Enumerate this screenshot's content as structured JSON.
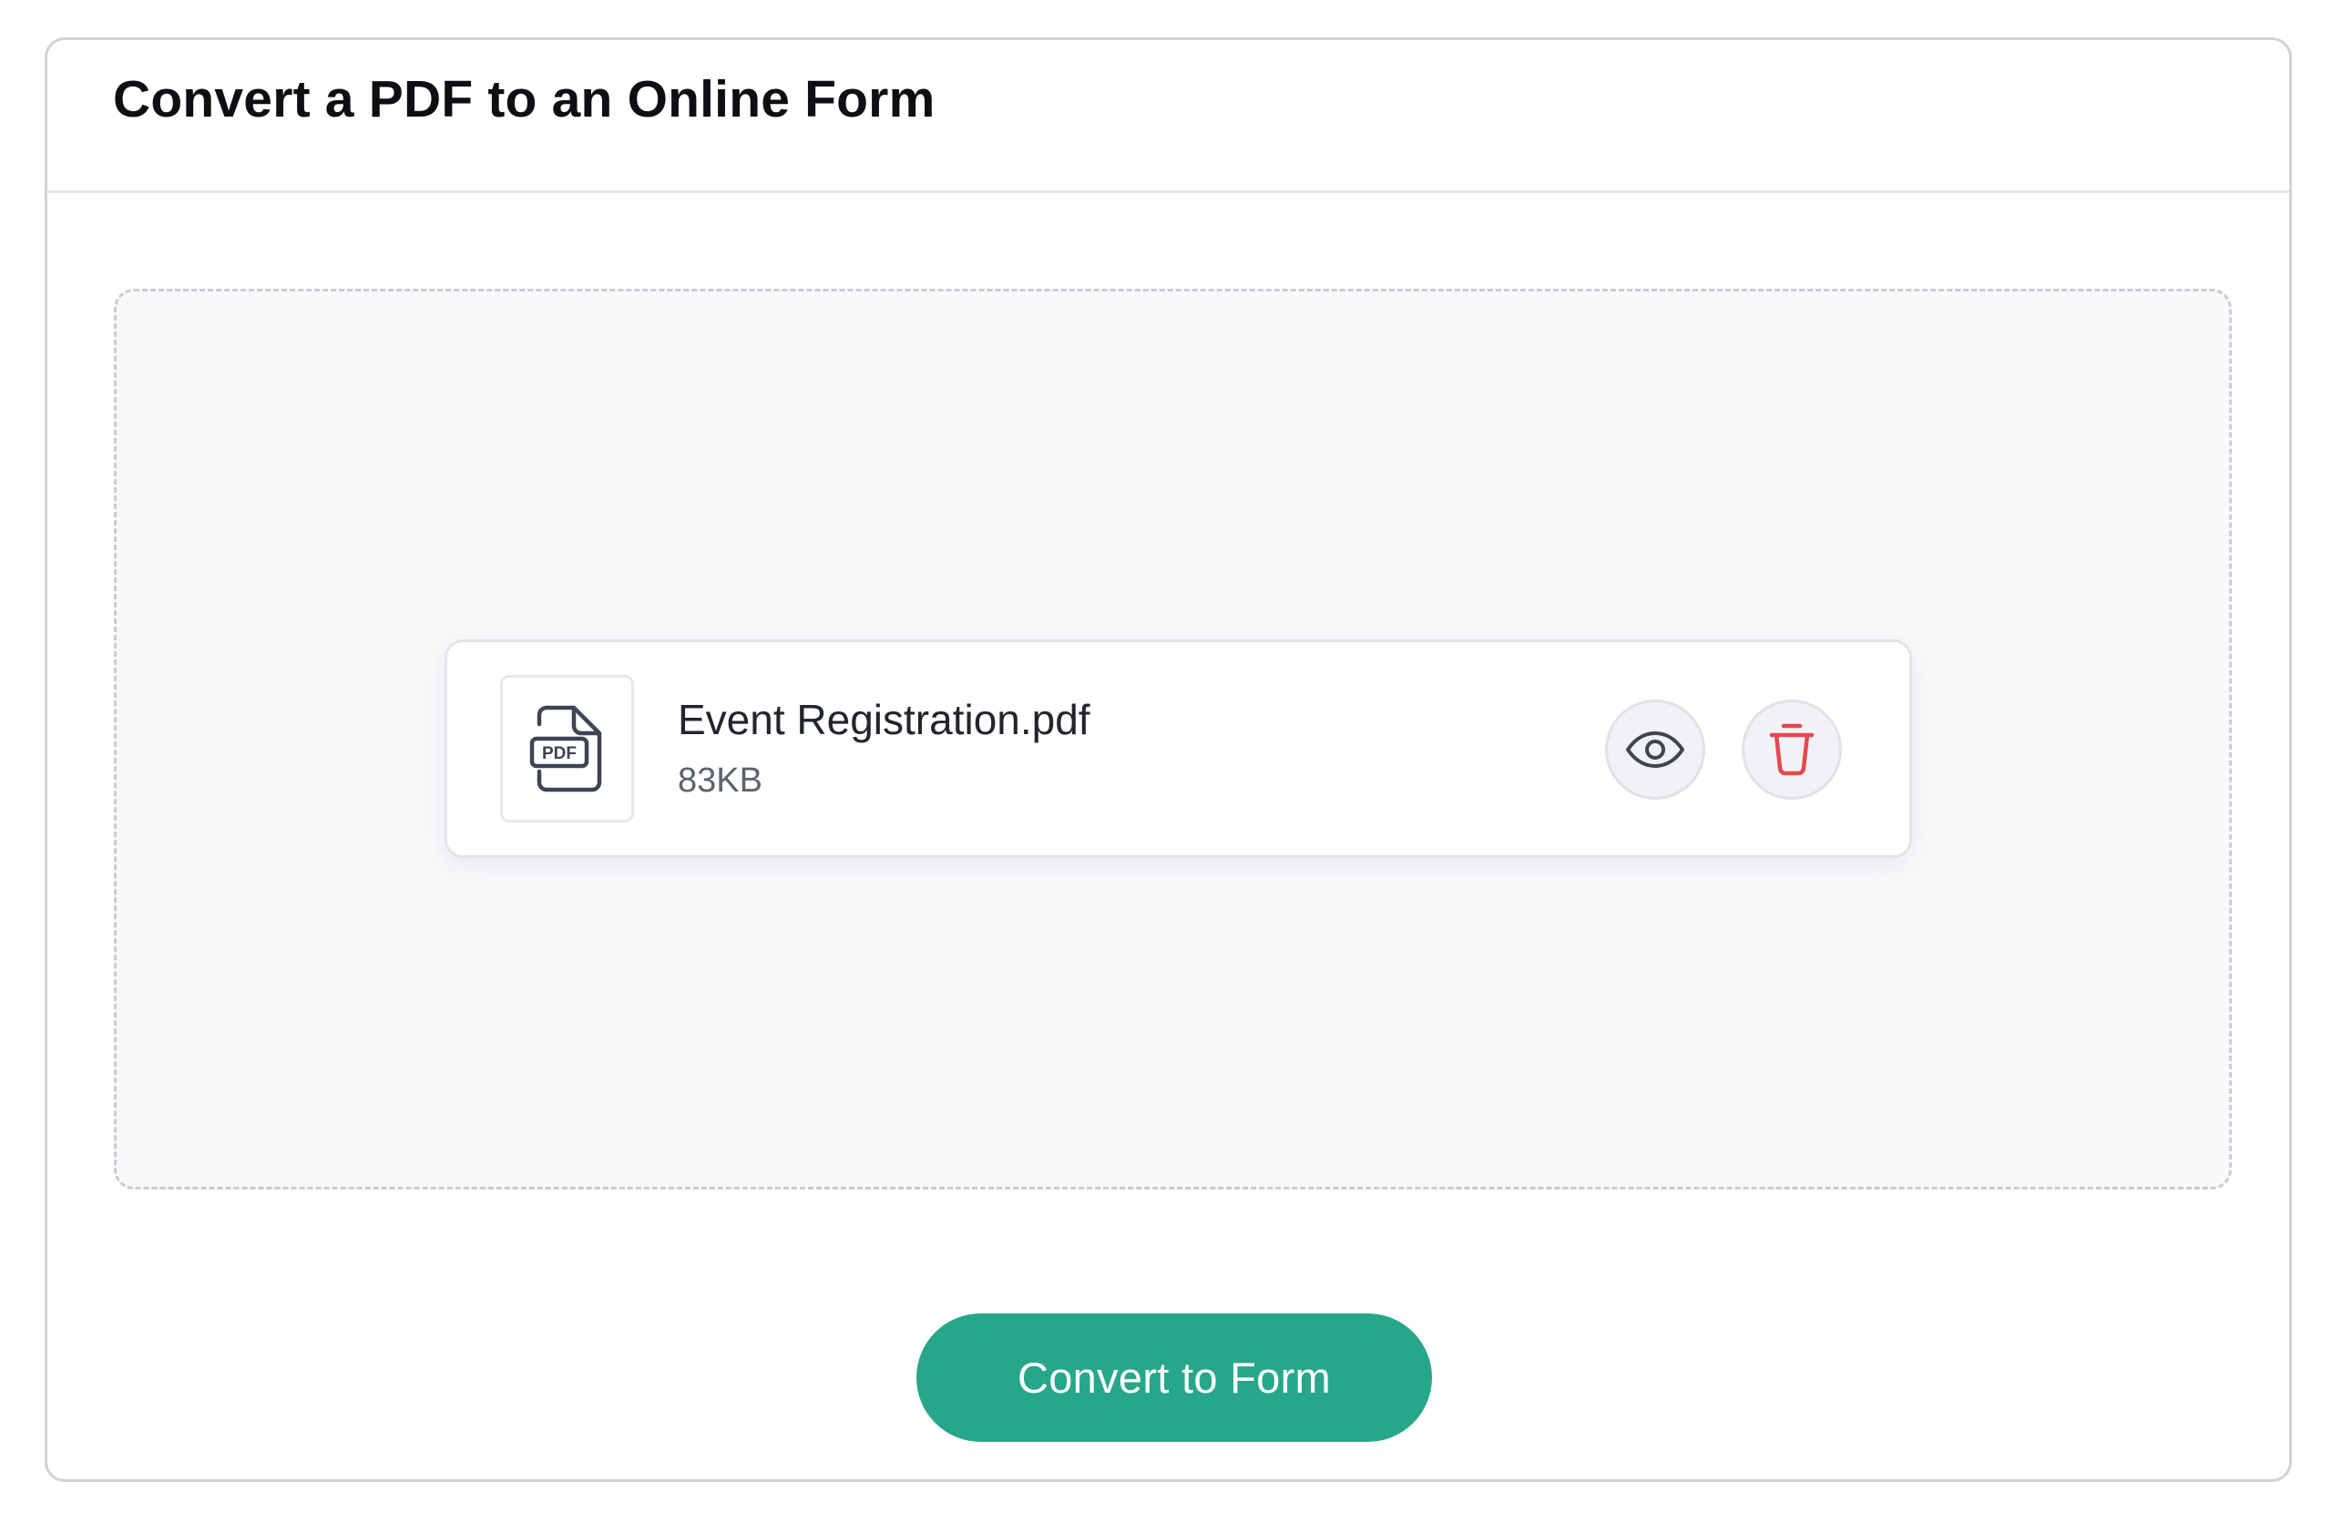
{
  "header": {
    "title": "Convert a PDF to an Online Form"
  },
  "upload": {
    "file": {
      "name": "Event Registration.pdf",
      "size": "83KB",
      "type_label": "PDF",
      "icon": "pdf-file-icon"
    },
    "actions": {
      "preview_icon": "eye-icon",
      "delete_icon": "trash-icon"
    }
  },
  "footer": {
    "convert_label": "Convert to Form"
  },
  "colors": {
    "accent": "#27a789",
    "delete": "#e5484d",
    "icon": "#3d4452"
  }
}
